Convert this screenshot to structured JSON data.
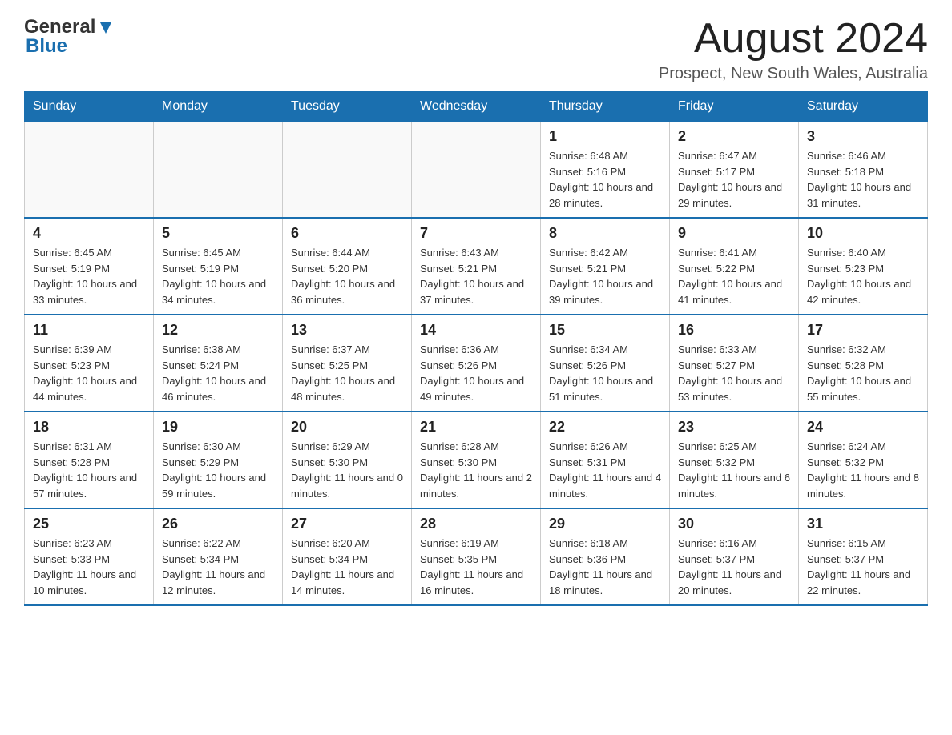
{
  "header": {
    "logo_general": "General",
    "logo_blue": "Blue",
    "month_title": "August 2024",
    "location": "Prospect, New South Wales, Australia"
  },
  "weekdays": [
    "Sunday",
    "Monday",
    "Tuesday",
    "Wednesday",
    "Thursday",
    "Friday",
    "Saturday"
  ],
  "weeks": [
    [
      {
        "day": "",
        "info": ""
      },
      {
        "day": "",
        "info": ""
      },
      {
        "day": "",
        "info": ""
      },
      {
        "day": "",
        "info": ""
      },
      {
        "day": "1",
        "info": "Sunrise: 6:48 AM\nSunset: 5:16 PM\nDaylight: 10 hours and 28 minutes."
      },
      {
        "day": "2",
        "info": "Sunrise: 6:47 AM\nSunset: 5:17 PM\nDaylight: 10 hours and 29 minutes."
      },
      {
        "day": "3",
        "info": "Sunrise: 6:46 AM\nSunset: 5:18 PM\nDaylight: 10 hours and 31 minutes."
      }
    ],
    [
      {
        "day": "4",
        "info": "Sunrise: 6:45 AM\nSunset: 5:19 PM\nDaylight: 10 hours and 33 minutes."
      },
      {
        "day": "5",
        "info": "Sunrise: 6:45 AM\nSunset: 5:19 PM\nDaylight: 10 hours and 34 minutes."
      },
      {
        "day": "6",
        "info": "Sunrise: 6:44 AM\nSunset: 5:20 PM\nDaylight: 10 hours and 36 minutes."
      },
      {
        "day": "7",
        "info": "Sunrise: 6:43 AM\nSunset: 5:21 PM\nDaylight: 10 hours and 37 minutes."
      },
      {
        "day": "8",
        "info": "Sunrise: 6:42 AM\nSunset: 5:21 PM\nDaylight: 10 hours and 39 minutes."
      },
      {
        "day": "9",
        "info": "Sunrise: 6:41 AM\nSunset: 5:22 PM\nDaylight: 10 hours and 41 minutes."
      },
      {
        "day": "10",
        "info": "Sunrise: 6:40 AM\nSunset: 5:23 PM\nDaylight: 10 hours and 42 minutes."
      }
    ],
    [
      {
        "day": "11",
        "info": "Sunrise: 6:39 AM\nSunset: 5:23 PM\nDaylight: 10 hours and 44 minutes."
      },
      {
        "day": "12",
        "info": "Sunrise: 6:38 AM\nSunset: 5:24 PM\nDaylight: 10 hours and 46 minutes."
      },
      {
        "day": "13",
        "info": "Sunrise: 6:37 AM\nSunset: 5:25 PM\nDaylight: 10 hours and 48 minutes."
      },
      {
        "day": "14",
        "info": "Sunrise: 6:36 AM\nSunset: 5:26 PM\nDaylight: 10 hours and 49 minutes."
      },
      {
        "day": "15",
        "info": "Sunrise: 6:34 AM\nSunset: 5:26 PM\nDaylight: 10 hours and 51 minutes."
      },
      {
        "day": "16",
        "info": "Sunrise: 6:33 AM\nSunset: 5:27 PM\nDaylight: 10 hours and 53 minutes."
      },
      {
        "day": "17",
        "info": "Sunrise: 6:32 AM\nSunset: 5:28 PM\nDaylight: 10 hours and 55 minutes."
      }
    ],
    [
      {
        "day": "18",
        "info": "Sunrise: 6:31 AM\nSunset: 5:28 PM\nDaylight: 10 hours and 57 minutes."
      },
      {
        "day": "19",
        "info": "Sunrise: 6:30 AM\nSunset: 5:29 PM\nDaylight: 10 hours and 59 minutes."
      },
      {
        "day": "20",
        "info": "Sunrise: 6:29 AM\nSunset: 5:30 PM\nDaylight: 11 hours and 0 minutes."
      },
      {
        "day": "21",
        "info": "Sunrise: 6:28 AM\nSunset: 5:30 PM\nDaylight: 11 hours and 2 minutes."
      },
      {
        "day": "22",
        "info": "Sunrise: 6:26 AM\nSunset: 5:31 PM\nDaylight: 11 hours and 4 minutes."
      },
      {
        "day": "23",
        "info": "Sunrise: 6:25 AM\nSunset: 5:32 PM\nDaylight: 11 hours and 6 minutes."
      },
      {
        "day": "24",
        "info": "Sunrise: 6:24 AM\nSunset: 5:32 PM\nDaylight: 11 hours and 8 minutes."
      }
    ],
    [
      {
        "day": "25",
        "info": "Sunrise: 6:23 AM\nSunset: 5:33 PM\nDaylight: 11 hours and 10 minutes."
      },
      {
        "day": "26",
        "info": "Sunrise: 6:22 AM\nSunset: 5:34 PM\nDaylight: 11 hours and 12 minutes."
      },
      {
        "day": "27",
        "info": "Sunrise: 6:20 AM\nSunset: 5:34 PM\nDaylight: 11 hours and 14 minutes."
      },
      {
        "day": "28",
        "info": "Sunrise: 6:19 AM\nSunset: 5:35 PM\nDaylight: 11 hours and 16 minutes."
      },
      {
        "day": "29",
        "info": "Sunrise: 6:18 AM\nSunset: 5:36 PM\nDaylight: 11 hours and 18 minutes."
      },
      {
        "day": "30",
        "info": "Sunrise: 6:16 AM\nSunset: 5:37 PM\nDaylight: 11 hours and 20 minutes."
      },
      {
        "day": "31",
        "info": "Sunrise: 6:15 AM\nSunset: 5:37 PM\nDaylight: 11 hours and 22 minutes."
      }
    ]
  ]
}
